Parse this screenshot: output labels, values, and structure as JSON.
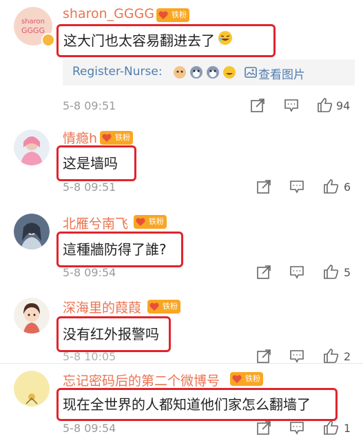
{
  "comments": [
    {
      "username": "sharon_GGGG",
      "avatar_text": "sharon GGGG",
      "badge": "铁粉",
      "text": "这大门也太容易翻进去了",
      "reply": {
        "name": "Register-Nurse:",
        "view_label": "查看图片"
      },
      "time": "5-8 09:51",
      "likes": "94"
    },
    {
      "username": "情瘾h",
      "badge": "铁粉",
      "text": "这是墙吗",
      "time": "5-8 09:51",
      "likes": "6"
    },
    {
      "username": "北雁兮南飞",
      "badge": "铁粉",
      "text": "這種牆防得了誰?",
      "time": "5-8 09:54",
      "likes": "5"
    },
    {
      "username": "深海里的葭葭",
      "badge": "铁粉",
      "text": "没有红外报警吗",
      "time": "5-8 10:05",
      "likes": "2"
    },
    {
      "username": "忘记密码后的第二个微博号",
      "badge": "铁粉",
      "text": "现在全世界的人都知道他们家怎么翻墙了",
      "time": "5-8 09:54",
      "likes": "1"
    }
  ],
  "icons": [
    "share-icon",
    "comment-icon",
    "like-icon",
    "emoji-icon",
    "image-icon"
  ],
  "colors": {
    "username": "#eb7350",
    "badge": "#f9a623",
    "highlight_box": "#e0242b",
    "link": "#507daf",
    "time": "#9b9b9b"
  }
}
